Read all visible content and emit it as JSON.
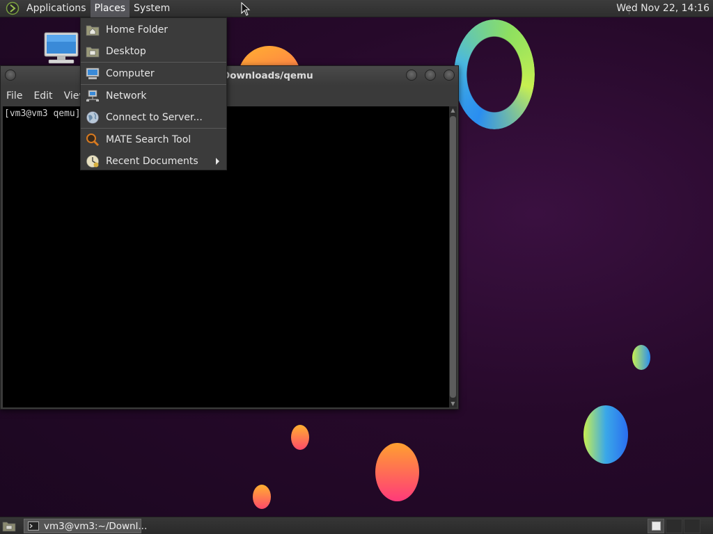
{
  "top_panel": {
    "menus": [
      "Applications",
      "Places",
      "System"
    ],
    "active_menu": "Places",
    "clock": "Wed Nov 22, 14:16"
  },
  "places_menu": {
    "items": [
      {
        "label": "Home Folder",
        "icon": "home-folder-icon"
      },
      {
        "label": "Desktop",
        "icon": "desktop-folder-icon"
      },
      {
        "label": "Computer",
        "icon": "computer-icon"
      },
      {
        "label": "Network",
        "icon": "network-icon"
      },
      {
        "label": "Connect to Server...",
        "icon": "globe-icon"
      },
      {
        "label": "MATE Search Tool",
        "icon": "search-icon"
      },
      {
        "label": "Recent Documents",
        "icon": "recent-documents-icon",
        "submenu": true
      }
    ]
  },
  "terminal": {
    "title": "Downloads/qemu",
    "menus": [
      "File",
      "Edit",
      "View"
    ],
    "prompt": "[vm3@vm3 qemu]"
  },
  "bottom_panel": {
    "task_label": "vm3@vm3:~/Downl..."
  },
  "colors": {
    "panel": "#2e2e2e",
    "menu_active": "#55555a",
    "desktop_bg": "#26092a",
    "terminal_bg": "#000000"
  }
}
